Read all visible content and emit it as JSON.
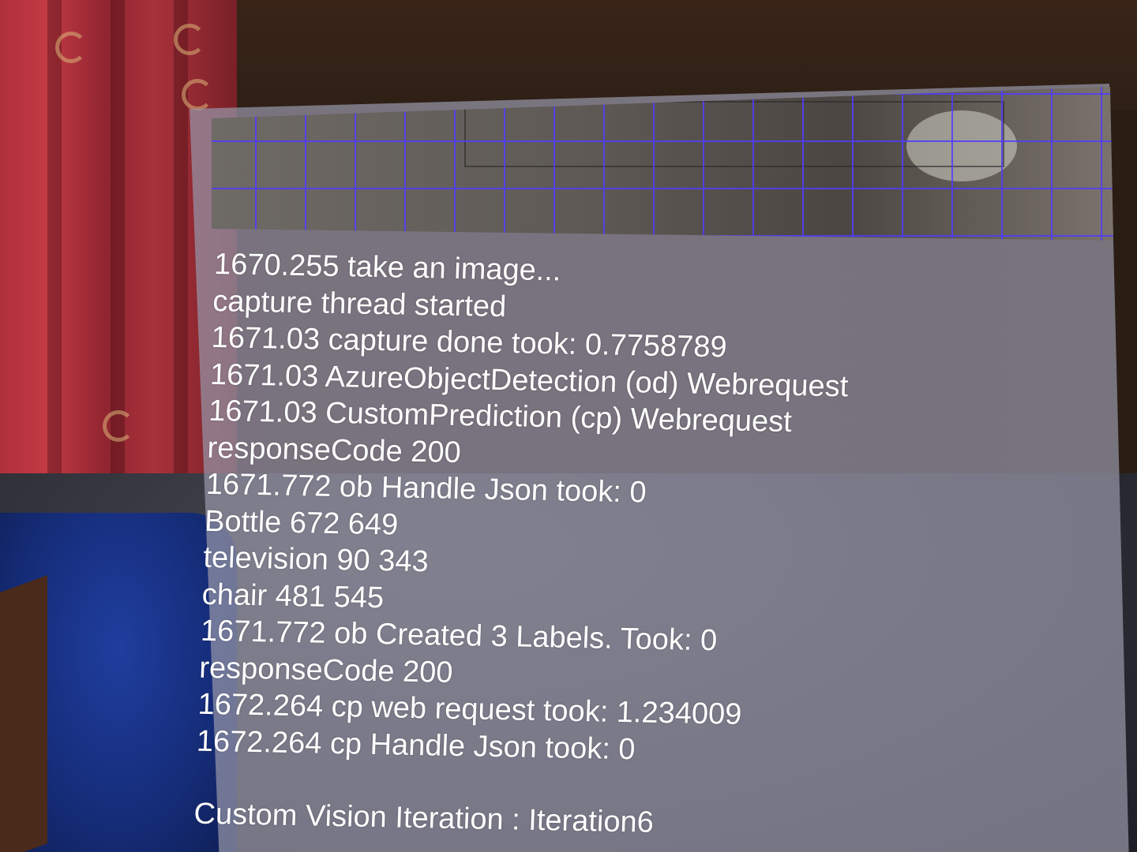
{
  "log": {
    "lines": [
      "1670.255 take an image...",
      "capture thread started",
      "1671.03 capture done took: 0.7758789",
      "1671.03 AzureObjectDetection (od) Webrequest",
      "1671.03 CustomPrediction (cp) Webrequest",
      "responseCode 200",
      "1671.772 ob Handle Json took: 0",
      "Bottle 672 649",
      "television 90 343",
      "chair 481 545",
      "1671.772 ob Created 3 Labels. Took: 0",
      "responseCode 200",
      "1672.264 cp web request took: 1.234009",
      "1672.264 cp Handle Json took: 0"
    ],
    "footer": "Custom Vision Iteration : Iteration6"
  },
  "colors": {
    "panel": "#9696a8",
    "grid": "#5040ff",
    "text": "#ffffff",
    "curtain": "#b0303a",
    "blanket": "#1f3e9e"
  }
}
